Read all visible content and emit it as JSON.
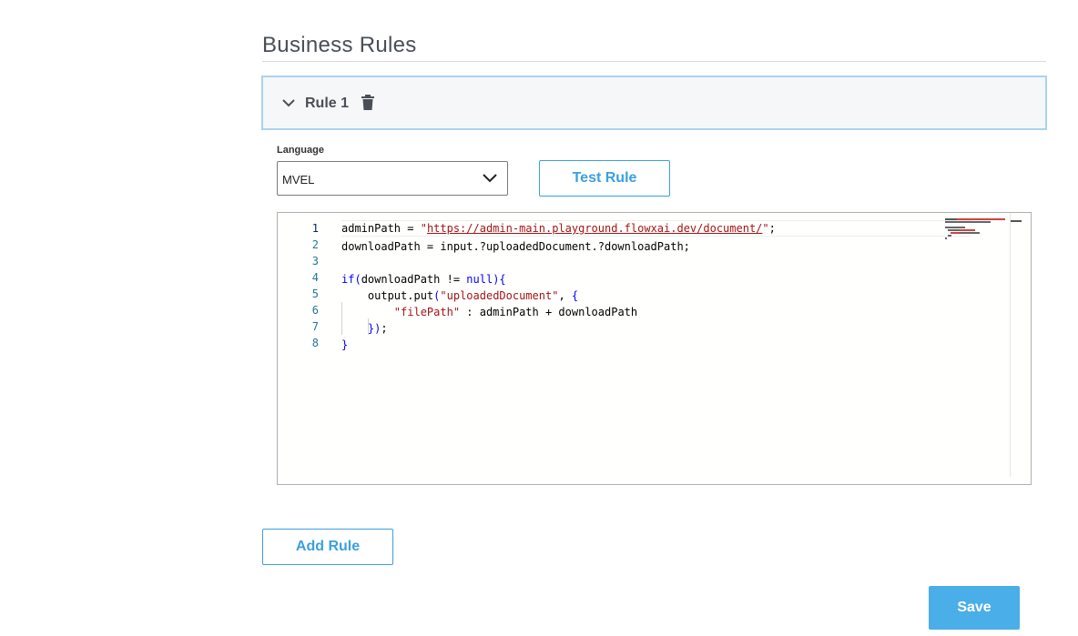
{
  "section": {
    "title": "Business Rules"
  },
  "rule": {
    "title": "Rule 1",
    "collapse_icon": "chevron-down-icon",
    "delete_icon": "trash-icon"
  },
  "language": {
    "label": "Language",
    "selected": "MVEL"
  },
  "buttons": {
    "test_rule": "Test Rule",
    "add_rule": "Add Rule",
    "save": "Save"
  },
  "editor": {
    "line_numbers": [
      "1",
      "2",
      "3",
      "4",
      "5",
      "6",
      "7",
      "8"
    ],
    "lines": [
      "adminPath = \"https://admin-main.playground.flowxai.dev/document/\";",
      "downloadPath = input.?uploadedDocument.?downloadPath;",
      "",
      "if(downloadPath != null){",
      "    output.put(\"uploadedDocument\", {",
      "        \"filePath\" : adminPath + downloadPath",
      "    });",
      "}"
    ]
  },
  "colors": {
    "accent": "#3aa0e0",
    "save_bg": "#4aaee8",
    "header_border": "#a9d3ee",
    "string": "#a31515",
    "keyword": "#0000ff",
    "line_number": "#237893"
  }
}
